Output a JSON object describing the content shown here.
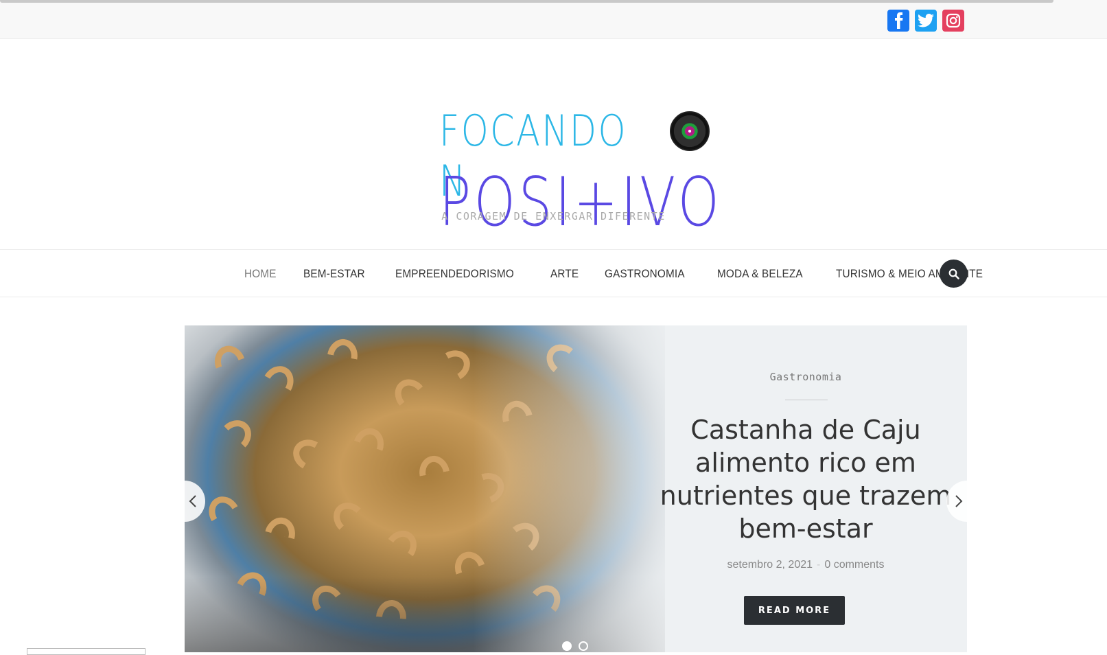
{
  "social": {
    "facebook_label": "f",
    "twitter_label": "twitter",
    "instagram_label": "instagram",
    "facebook_icon": "facebook-icon",
    "twitter_icon": "twitter-icon",
    "instagram_icon": "instagram-icon"
  },
  "logo": {
    "line1": "FOCANDO N",
    "line2": "POSI+IVO",
    "tagline": "A CORAGEM DE ENXERGAR DIFERENTE"
  },
  "nav": {
    "items": [
      {
        "label": "HOME",
        "active": true
      },
      {
        "label": "BEM-ESTAR"
      },
      {
        "label": "EMPREENDEDORISMO"
      },
      {
        "label": "ARTE"
      },
      {
        "label": "GASTRONOMIA"
      },
      {
        "label": "MODA & BELEZA"
      },
      {
        "label": "TURISMO & MEIO AMBIENTE"
      }
    ],
    "search_icon": "search-icon"
  },
  "slider": {
    "category": "Gastronomia",
    "title": "Castanha de Caju alimento rico em nutrientes que trazem bem-estar",
    "date": "setembro 2, 2021",
    "separator": "-",
    "comments": "0 comments",
    "read_more": "READ MORE",
    "current_slide": 1,
    "total_slides": 2
  },
  "colors": {
    "dark": "#2b2f33",
    "logo_blue": "#2cb7e6",
    "logo_purple": "#5a49e3"
  }
}
